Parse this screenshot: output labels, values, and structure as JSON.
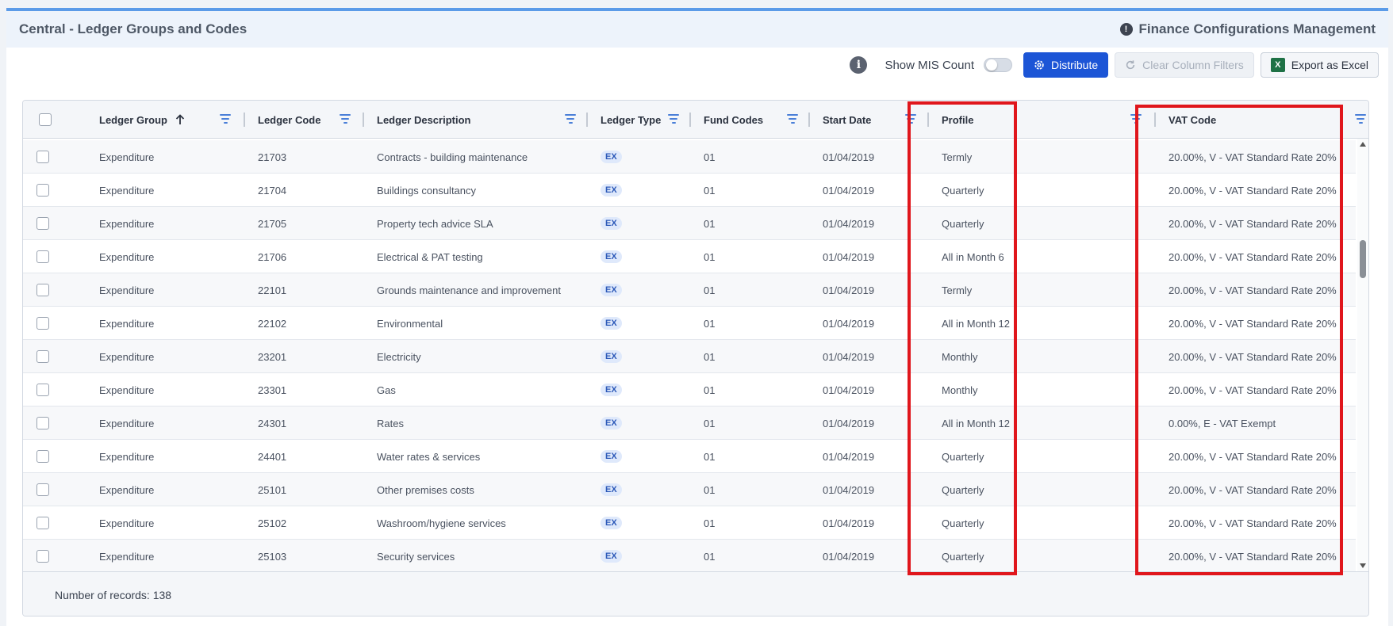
{
  "panel": {
    "title": "Central - Ledger Groups and Codes",
    "right_title": "Finance Configurations Management",
    "alert_glyph": "!"
  },
  "toolbar": {
    "info_glyph": "i",
    "show_mis_label": "Show MIS Count",
    "show_mis_on": false,
    "distribute_label": "Distribute",
    "clear_filters_label": "Clear Column Filters",
    "export_label": "Export as Excel",
    "excel_glyph": "X"
  },
  "grid": {
    "columns": [
      {
        "key": "group",
        "label": "Ledger Group",
        "sort": "asc"
      },
      {
        "key": "code",
        "label": "Ledger Code"
      },
      {
        "key": "desc",
        "label": "Ledger Description"
      },
      {
        "key": "type",
        "label": "Ledger Type"
      },
      {
        "key": "fund",
        "label": "Fund Codes"
      },
      {
        "key": "start",
        "label": "Start Date"
      },
      {
        "key": "profile",
        "label": "Profile"
      },
      {
        "key": "vat",
        "label": "VAT Code"
      }
    ],
    "rows": [
      {
        "group": "Expenditure",
        "code": "21703",
        "desc": "Contracts - building maintenance",
        "type": "EX",
        "fund": "01",
        "start": "01/04/2019",
        "profile": "Termly",
        "vat": "20.00%, V - VAT Standard Rate 20%"
      },
      {
        "group": "Expenditure",
        "code": "21704",
        "desc": "Buildings consultancy",
        "type": "EX",
        "fund": "01",
        "start": "01/04/2019",
        "profile": "Quarterly",
        "vat": "20.00%, V - VAT Standard Rate 20%"
      },
      {
        "group": "Expenditure",
        "code": "21705",
        "desc": "Property tech advice SLA",
        "type": "EX",
        "fund": "01",
        "start": "01/04/2019",
        "profile": "Quarterly",
        "vat": "20.00%, V - VAT Standard Rate 20%"
      },
      {
        "group": "Expenditure",
        "code": "21706",
        "desc": "Electrical & PAT testing",
        "type": "EX",
        "fund": "01",
        "start": "01/04/2019",
        "profile": "All in Month 6",
        "vat": "20.00%, V - VAT Standard Rate 20%"
      },
      {
        "group": "Expenditure",
        "code": "22101",
        "desc": "Grounds maintenance and improvement",
        "type": "EX",
        "fund": "01",
        "start": "01/04/2019",
        "profile": "Termly",
        "vat": "20.00%, V - VAT Standard Rate 20%"
      },
      {
        "group": "Expenditure",
        "code": "22102",
        "desc": "Environmental",
        "type": "EX",
        "fund": "01",
        "start": "01/04/2019",
        "profile": "All in Month 12",
        "vat": "20.00%, V - VAT Standard Rate 20%"
      },
      {
        "group": "Expenditure",
        "code": "23201",
        "desc": "Electricity",
        "type": "EX",
        "fund": "01",
        "start": "01/04/2019",
        "profile": "Monthly",
        "vat": "20.00%, V - VAT Standard Rate 20%"
      },
      {
        "group": "Expenditure",
        "code": "23301",
        "desc": "Gas",
        "type": "EX",
        "fund": "01",
        "start": "01/04/2019",
        "profile": "Monthly",
        "vat": "20.00%, V - VAT Standard Rate 20%"
      },
      {
        "group": "Expenditure",
        "code": "24301",
        "desc": "Rates",
        "type": "EX",
        "fund": "01",
        "start": "01/04/2019",
        "profile": "All in Month 12",
        "vat": "0.00%, E - VAT Exempt"
      },
      {
        "group": "Expenditure",
        "code": "24401",
        "desc": "Water rates & services",
        "type": "EX",
        "fund": "01",
        "start": "01/04/2019",
        "profile": "Quarterly",
        "vat": "20.00%, V - VAT Standard Rate 20%"
      },
      {
        "group": "Expenditure",
        "code": "25101",
        "desc": "Other premises costs",
        "type": "EX",
        "fund": "01",
        "start": "01/04/2019",
        "profile": "Quarterly",
        "vat": "20.00%, V - VAT Standard Rate 20%"
      },
      {
        "group": "Expenditure",
        "code": "25102",
        "desc": "Washroom/hygiene services",
        "type": "EX",
        "fund": "01",
        "start": "01/04/2019",
        "profile": "Quarterly",
        "vat": "20.00%, V - VAT Standard Rate 20%"
      },
      {
        "group": "Expenditure",
        "code": "25103",
        "desc": "Security services",
        "type": "EX",
        "fund": "01",
        "start": "01/04/2019",
        "profile": "Quarterly",
        "vat": "20.00%, V - VAT Standard Rate 20%"
      }
    ],
    "footer": "Number of records: 138"
  },
  "colors": {
    "accent": "#1c55d6",
    "highlight": "#e0161c",
    "tag_bg": "#dfe9fb"
  },
  "icons": [
    "alert-icon",
    "info-icon",
    "settings-gear-icon",
    "refresh-icon",
    "excel-icon",
    "filter-icon",
    "sort-arrow-up-icon"
  ]
}
